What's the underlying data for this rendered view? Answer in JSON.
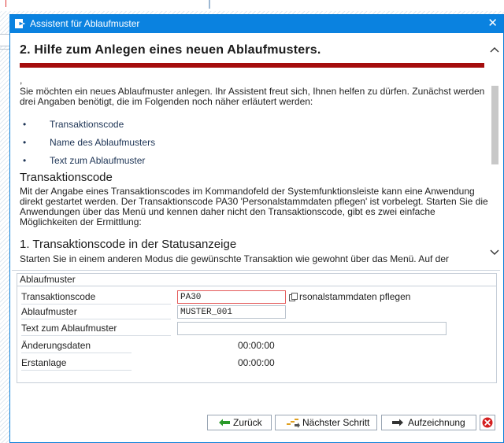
{
  "window": {
    "title": "Assistent für Ablaufmuster",
    "close_symbol": "✕",
    "title_icon": "wizard-icon"
  },
  "help": {
    "heading": "2. Hilfe zum Anlegen eines neuen Ablaufmusters.",
    "heading_bar_color": "#a50d0d",
    "comma": ",",
    "intro": "Sie möchten ein neues Ablaufmuster anlegen. Ihr Assistent freut sich, Ihnen helfen zu dürfen. Zunächst werden drei Angaben benötigt, die im Folgenden noch näher erläutert werden:",
    "bullets": [
      {
        "dot": "•",
        "text": "Transaktionscode"
      },
      {
        "dot": "•",
        "text": "Name des Ablaufmusters"
      },
      {
        "dot": "•",
        "text": "Text zum Ablaufmuster"
      }
    ],
    "section1_title": "Transaktionscode",
    "section1_text": "Mit der Angabe eines Transaktionscodes im Kommandofeld der Systemfunktionsleiste kann eine Anwendung direkt gestartet werden. Der Transaktionscode PA30 'Personalstammdaten pflegen' ist vorbelegt. Starten Sie die Anwendungen über das Menü und kennen daher nicht den Transaktionscode, gibt es zwei einfache Möglichkeiten der Ermittlung:",
    "section2_title": "1. Transaktionscode in der Statusanzeige",
    "section2_text": "Starten Sie in einem anderen Modus die gewünschte Transaktion wie gewohnt über das Menü. Auf der"
  },
  "scrollbar": {
    "up": "^",
    "down": "v"
  },
  "form": {
    "group_title": "Ablaufmuster",
    "fields": {
      "tcode": {
        "label": "Transaktionscode",
        "value": "PA30",
        "description": "rsonalstammdaten pflegen"
      },
      "name": {
        "label": "Ablaufmuster",
        "value": "MUSTER_001"
      },
      "text": {
        "label": "Text zum Ablaufmuster",
        "value": ""
      },
      "changed": {
        "label": "Änderungsdaten",
        "value": "00:00:00"
      },
      "created": {
        "label": "Erstanlage",
        "value": "00:00:00"
      }
    }
  },
  "buttons": {
    "back": "Zurück",
    "next": "Nächster Schritt",
    "record": "Aufzeichnung"
  },
  "colors": {
    "title_bar": "#0a82e0",
    "text_blue": "#1d3455",
    "cancel_red": "#d42020"
  }
}
